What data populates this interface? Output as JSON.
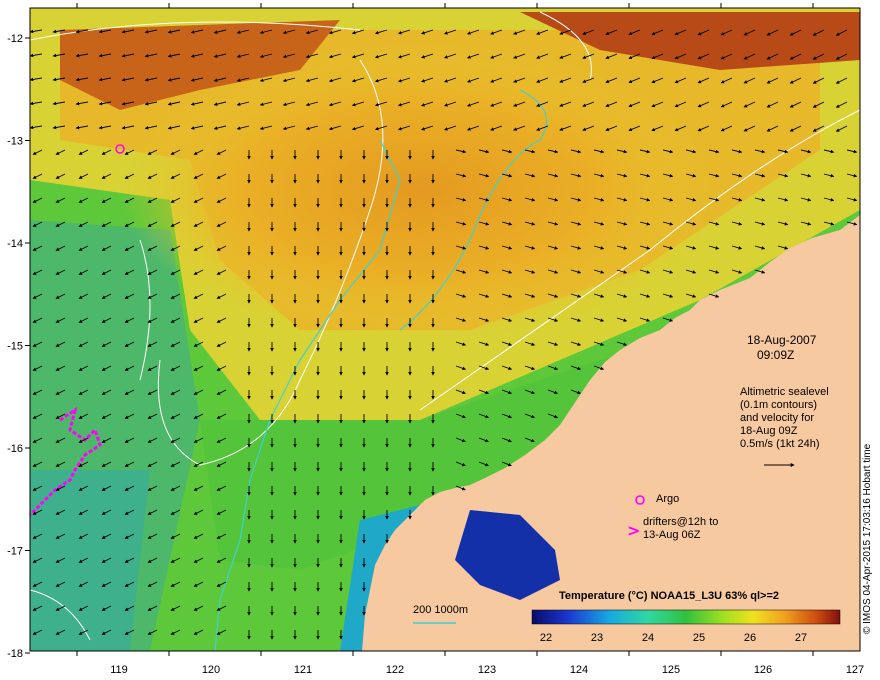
{
  "map": {
    "lon_ticks": [
      "119",
      "120",
      "121",
      "122",
      "123",
      "124",
      "125",
      "126",
      "127"
    ],
    "lat_ticks": [
      "-12",
      "-13",
      "-14",
      "-15",
      "-16",
      "-17",
      "-18"
    ]
  },
  "annotation": {
    "date": "18-Aug-2007",
    "time": "09:09Z",
    "altimetry_lines": [
      "Altimetric sealevel",
      "(0.1m contours)",
      "and velocity for",
      "18-Aug 09Z",
      "0.5m/s (1kt 24h)"
    ]
  },
  "legend": {
    "argo_label": "Argo",
    "drifters_label_1": "drifters@12h to",
    "drifters_label_2": "13-Aug 06Z",
    "depth_label": "200  1000m"
  },
  "colorbar": {
    "title": "Temperature (°C) NOAA15_L3U 63% ql>=2",
    "ticks": [
      "22",
      "23",
      "24",
      "25",
      "26",
      "27"
    ]
  },
  "credit": "© IMOS 04-Apr-2015 17:03:16 Hobart time",
  "colors": {
    "land": "#f7c9a0",
    "sst_cold": "#1a2a9a",
    "sst_mid": "#22c55a",
    "sst_warm": "#e28a10",
    "sst_hot": "#9a2a10",
    "argo": "#ff00ff",
    "contour": "#ffffff",
    "isobath": "#40d0d0"
  }
}
